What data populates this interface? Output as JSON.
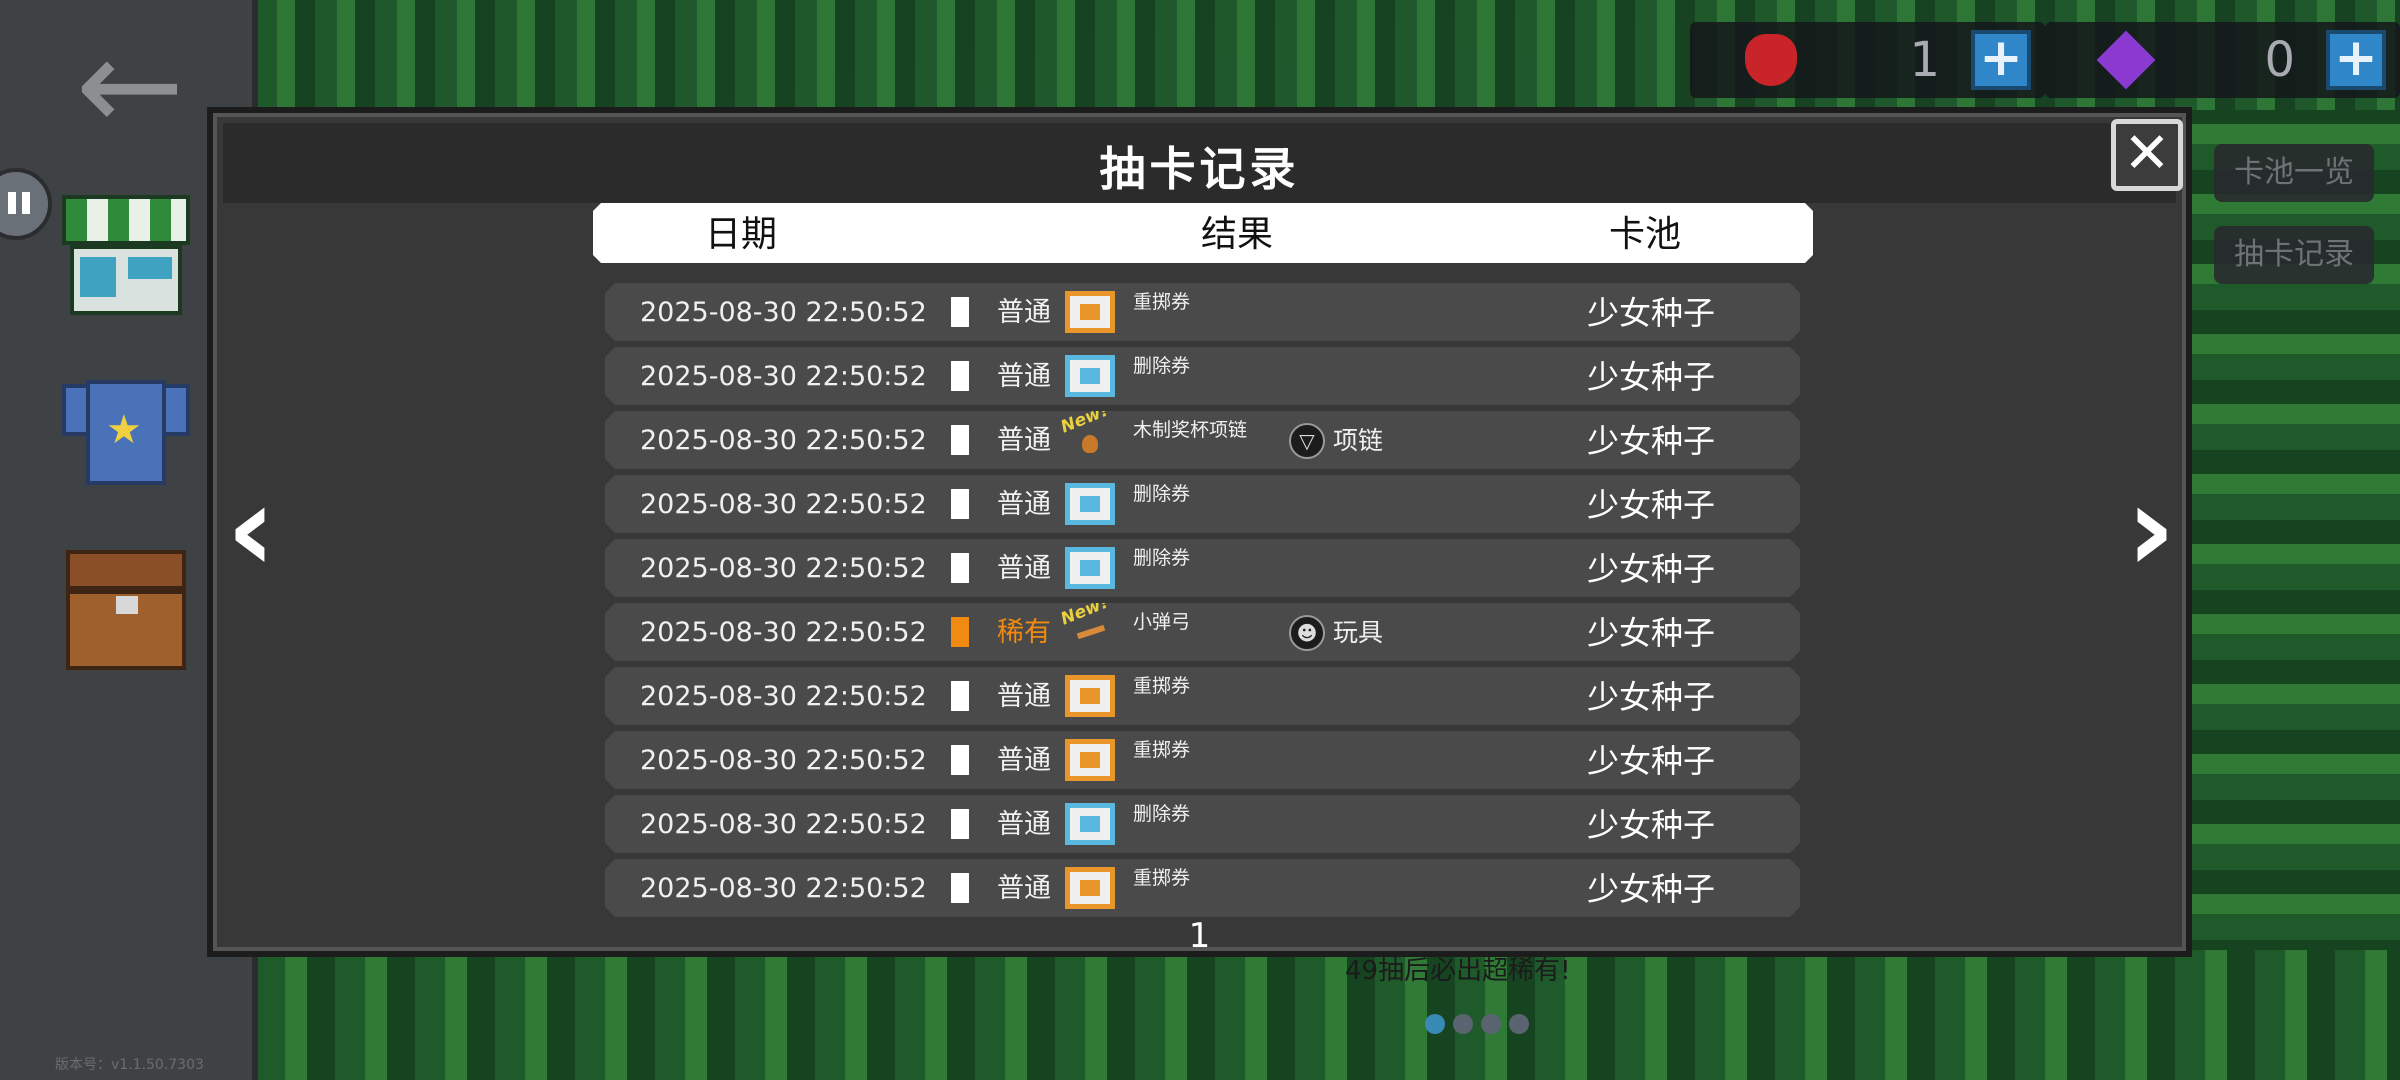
{
  "modal": {
    "title": "抽卡记录",
    "close_symbol": "✕",
    "columns": {
      "date": "日期",
      "result": "结果",
      "pool": "卡池"
    },
    "page": "1",
    "prev_symbol": "‹",
    "next_symbol": "›",
    "rows": [
      {
        "date": "2025-08-30 22:50:52",
        "rarity": "普通",
        "rarity_level": "common",
        "icon": "reroll-ticket-icon",
        "item": "重掷券",
        "new": "",
        "category_icon": "",
        "category": "",
        "pool": "少女种子"
      },
      {
        "date": "2025-08-30 22:50:52",
        "rarity": "普通",
        "rarity_level": "common",
        "icon": "delete-ticket-icon",
        "item": "删除券",
        "new": "",
        "category_icon": "",
        "category": "",
        "pool": "少女种子"
      },
      {
        "date": "2025-08-30 22:50:52",
        "rarity": "普通",
        "rarity_level": "common",
        "icon": "wooden-trophy-necklace-icon",
        "item": "木制奖杯项链",
        "new": "New!",
        "category_icon": "necklace-icon",
        "category": "项链",
        "pool": "少女种子"
      },
      {
        "date": "2025-08-30 22:50:52",
        "rarity": "普通",
        "rarity_level": "common",
        "icon": "delete-ticket-icon",
        "item": "删除券",
        "new": "",
        "category_icon": "",
        "category": "",
        "pool": "少女种子"
      },
      {
        "date": "2025-08-30 22:50:52",
        "rarity": "普通",
        "rarity_level": "common",
        "icon": "delete-ticket-icon",
        "item": "删除券",
        "new": "",
        "category_icon": "",
        "category": "",
        "pool": "少女种子"
      },
      {
        "date": "2025-08-30 22:50:52",
        "rarity": "稀有",
        "rarity_level": "rare",
        "icon": "slingshot-icon",
        "item": "小弹弓",
        "new": "New!",
        "category_icon": "toy-icon",
        "category": "玩具",
        "pool": "少女种子"
      },
      {
        "date": "2025-08-30 22:50:52",
        "rarity": "普通",
        "rarity_level": "common",
        "icon": "reroll-ticket-icon",
        "item": "重掷券",
        "new": "",
        "category_icon": "",
        "category": "",
        "pool": "少女种子"
      },
      {
        "date": "2025-08-30 22:50:52",
        "rarity": "普通",
        "rarity_level": "common",
        "icon": "reroll-ticket-icon",
        "item": "重掷券",
        "new": "",
        "category_icon": "",
        "category": "",
        "pool": "少女种子"
      },
      {
        "date": "2025-08-30 22:50:52",
        "rarity": "普通",
        "rarity_level": "common",
        "icon": "delete-ticket-icon",
        "item": "删除券",
        "new": "",
        "category_icon": "",
        "category": "",
        "pool": "少女种子"
      },
      {
        "date": "2025-08-30 22:50:52",
        "rarity": "普通",
        "rarity_level": "common",
        "icon": "reroll-ticket-icon",
        "item": "重掷券",
        "new": "",
        "category_icon": "",
        "category": "",
        "pool": "少女种子"
      }
    ]
  },
  "currency": {
    "strawberry": {
      "icon": "strawberry-icon",
      "value": "1",
      "plus": "+"
    },
    "gem": {
      "icon": "gem-icon",
      "value": "0",
      "plus": "+"
    }
  },
  "side_tabs": {
    "pool_list": "卡池一览",
    "draw_record": "抽卡记录"
  },
  "sidebar": {
    "back_symbol": "←",
    "icons": [
      "back-arrow-icon",
      "shop-icon",
      "shirt-icon",
      "chest-icon",
      "pause-icon"
    ],
    "version": "版本号：v1.1.50.7303"
  },
  "background": {
    "hint": "49抽后必出超稀有!"
  },
  "colors": {
    "rare": "#f08a10",
    "common": "#ffffff",
    "modal_bg": "#383838",
    "row_bg": "#4a4a4a",
    "plus_button": "#2f86c8"
  }
}
